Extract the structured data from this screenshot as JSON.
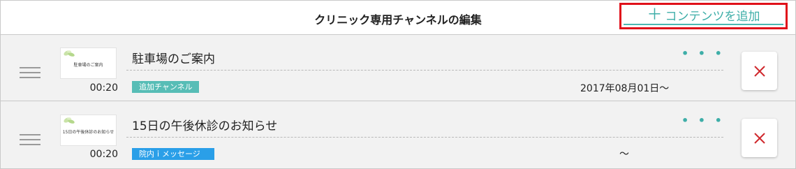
{
  "header": {
    "title": "クリニック専用チャンネルの編集",
    "add_button": {
      "plus": "＋",
      "label": "コンテンツを追加"
    }
  },
  "colors": {
    "accent": "#3eaea8",
    "highlight_border": "#e0101a",
    "badge_teal": "#57bdb6",
    "badge_blue": "#2a9fe8",
    "delete_icon": "#d0292e"
  },
  "items": [
    {
      "thumb_text": "駐車場のご案内",
      "duration": "00:20",
      "title": "駐車場のご案内",
      "menu": "• • •",
      "badge": "追加チャンネル",
      "badge_color": "teal",
      "date": "2017年08月01日〜",
      "delete_icon": "close-icon"
    },
    {
      "thumb_text": "15日の午後休診のお知らせ",
      "duration": "00:20",
      "title": "15日の午後休診のお知らせ",
      "menu": "• • •",
      "badge": "院内ｉメッセージ",
      "badge_color": "blue",
      "date": "〜",
      "delete_icon": "close-icon"
    }
  ]
}
